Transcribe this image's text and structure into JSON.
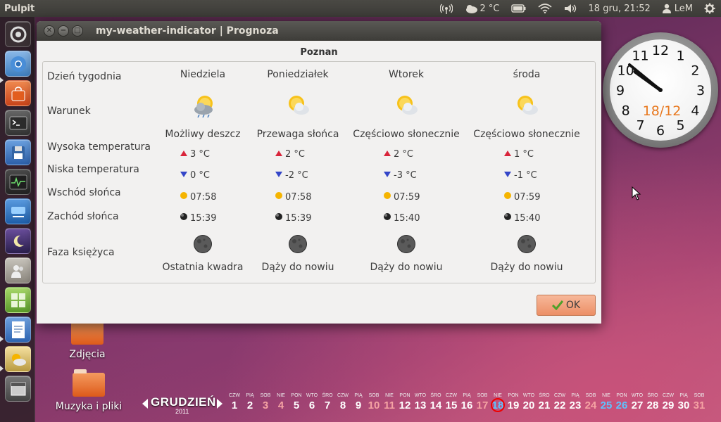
{
  "panel": {
    "title": "Pulpit",
    "weather_temp": "2 °C",
    "datetime": "18 gru, 21:52",
    "user": "LeM"
  },
  "window": {
    "title": "my-weather-indicator | Prognoza",
    "city": "Poznan",
    "ok_label": "OK",
    "row_labels": {
      "day": "Dzień tygodnia",
      "condition": "Warunek",
      "high": "Wysoka temperatura",
      "low": "Niska temperatura",
      "sunrise": "Wschód słońca",
      "sunset": "Zachód słońca",
      "moon": "Faza księżyca"
    },
    "days": [
      {
        "name": "Niedziela",
        "condition": "Możliwy deszcz",
        "icon": "rain-cloud-icon",
        "high": "3 °C",
        "low": "0 °C",
        "sunrise": "07:58",
        "sunset": "15:39",
        "moon": "Ostatnia kwadra"
      },
      {
        "name": "Poniedziałek",
        "condition": "Przewaga słońca",
        "icon": "mostly-sunny-icon",
        "high": "2 °C",
        "low": "-2 °C",
        "sunrise": "07:58",
        "sunset": "15:39",
        "moon": "Dąży do nowiu"
      },
      {
        "name": "Wtorek",
        "condition": "Częściowo słonecznie",
        "icon": "partly-cloudy-icon",
        "high": "2 °C",
        "low": "-3 °C",
        "sunrise": "07:59",
        "sunset": "15:40",
        "moon": "Dąży do nowiu"
      },
      {
        "name": "środa",
        "condition": "Częściowo słonecznie",
        "icon": "partly-cloudy-icon",
        "high": "1 °C",
        "low": "-1 °C",
        "sunrise": "07:59",
        "sunset": "15:40",
        "moon": "Dąży do nowiu"
      }
    ]
  },
  "clock": {
    "date": "18/12",
    "numbers": [
      "12",
      "1",
      "2",
      "3",
      "4",
      "5",
      "6",
      "7",
      "8",
      "9",
      "10",
      "11"
    ]
  },
  "desktop": {
    "icons": [
      {
        "label": "Zdjęcia"
      },
      {
        "label": "Muzyka i pliki"
      }
    ]
  },
  "calendar": {
    "month": "GRUDZIEŃ",
    "year": "2011",
    "days": [
      {
        "dn": "CZW",
        "num": "1",
        "kind": ""
      },
      {
        "dn": "PIĄ",
        "num": "2",
        "kind": ""
      },
      {
        "dn": "SOB",
        "num": "3",
        "kind": "weekend"
      },
      {
        "dn": "NIE",
        "num": "4",
        "kind": "weekend"
      },
      {
        "dn": "PON",
        "num": "5",
        "kind": ""
      },
      {
        "dn": "WTO",
        "num": "6",
        "kind": ""
      },
      {
        "dn": "ŚRO",
        "num": "7",
        "kind": ""
      },
      {
        "dn": "CZW",
        "num": "8",
        "kind": ""
      },
      {
        "dn": "PIĄ",
        "num": "9",
        "kind": ""
      },
      {
        "dn": "SOB",
        "num": "10",
        "kind": "weekend"
      },
      {
        "dn": "NIE",
        "num": "11",
        "kind": "weekend"
      },
      {
        "dn": "PON",
        "num": "12",
        "kind": ""
      },
      {
        "dn": "WTO",
        "num": "13",
        "kind": ""
      },
      {
        "dn": "ŚRO",
        "num": "14",
        "kind": ""
      },
      {
        "dn": "CZW",
        "num": "15",
        "kind": ""
      },
      {
        "dn": "PIĄ",
        "num": "16",
        "kind": ""
      },
      {
        "dn": "SOB",
        "num": "17",
        "kind": "weekend"
      },
      {
        "dn": "NIE",
        "num": "18",
        "kind": "today"
      },
      {
        "dn": "PON",
        "num": "19",
        "kind": ""
      },
      {
        "dn": "WTO",
        "num": "20",
        "kind": ""
      },
      {
        "dn": "ŚRO",
        "num": "21",
        "kind": ""
      },
      {
        "dn": "CZW",
        "num": "22",
        "kind": ""
      },
      {
        "dn": "PIĄ",
        "num": "23",
        "kind": ""
      },
      {
        "dn": "SOB",
        "num": "24",
        "kind": "weekend"
      },
      {
        "dn": "NIE",
        "num": "25",
        "kind": "holiday"
      },
      {
        "dn": "PON",
        "num": "26",
        "kind": "holiday"
      },
      {
        "dn": "WTO",
        "num": "27",
        "kind": ""
      },
      {
        "dn": "ŚRO",
        "num": "28",
        "kind": ""
      },
      {
        "dn": "CZW",
        "num": "29",
        "kind": ""
      },
      {
        "dn": "PIĄ",
        "num": "30",
        "kind": ""
      },
      {
        "dn": "SOB",
        "num": "31",
        "kind": "weekend"
      }
    ]
  },
  "colors": {
    "accent": "#e95420",
    "ok_button": "#ec8f66",
    "clock_date": "#e8781e",
    "holiday": "#5ec2ff",
    "weekend": "#f5a3a3"
  }
}
